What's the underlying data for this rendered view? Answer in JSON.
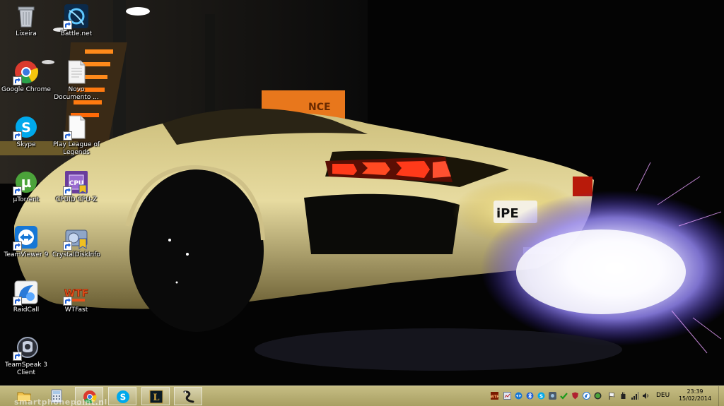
{
  "desktop": {
    "icons": [
      {
        "label": "Lixeira",
        "icon": "recycle-bin-icon"
      },
      {
        "label": "Battle.net",
        "icon": "battlenet-icon"
      },
      {
        "label": "Google Chrome",
        "icon": "chrome-icon"
      },
      {
        "label": "Novo Documento ...",
        "icon": "text-document-icon"
      },
      {
        "label": "Skype",
        "icon": "skype-icon"
      },
      {
        "label": "Play League of Legends",
        "icon": "league-document-icon"
      },
      {
        "label": "µTorrent",
        "icon": "utorrent-icon"
      },
      {
        "label": "CPUID CPU-Z",
        "icon": "cpuz-icon"
      },
      {
        "label": "TeamViewer 9",
        "icon": "teamviewer-icon"
      },
      {
        "label": "CrystalDiskInfo",
        "icon": "crystaldiskinfo-icon"
      },
      {
        "label": "RaidCall",
        "icon": "raidcall-icon"
      },
      {
        "label": "WTFast",
        "icon": "wtfast-icon"
      },
      {
        "label": "TeamSpeak 3 Client",
        "icon": "teamspeak-icon"
      }
    ],
    "wallpaper_text": {
      "sign": "NCE",
      "plate": "iPE"
    }
  },
  "taskbar": {
    "pinned": [
      {
        "app": "File Explorer",
        "icon": "file-explorer-icon"
      },
      {
        "app": "Calculator",
        "icon": "calculator-icon"
      },
      {
        "app": "Google Chrome",
        "icon": "chrome-icon"
      },
      {
        "app": "Skype",
        "icon": "skype-icon"
      },
      {
        "app": "League of Legends",
        "icon": "league-of-legends-icon"
      },
      {
        "app": "Unknown app",
        "icon": "serpent-app-icon"
      }
    ],
    "watermark": "smartphonepoint.nl",
    "tray_icons": [
      "wtfast-tray-icon",
      "network-monitor-icon",
      "teamviewer-tray-icon",
      "bluetooth-icon",
      "skype-tray-icon",
      "app-tray-icon",
      "checkmark-tray-icon",
      "shield-tray-icon",
      "raidcall-tray-icon",
      "utorrent-tray-icon",
      "flag-icon",
      "power-icon",
      "signal-bars-icon",
      "volume-icon"
    ],
    "language": "DEU",
    "time": "23:39",
    "date": "15/02/2014"
  },
  "colors": {
    "taskbar_top": "#c6bd84",
    "taskbar_bottom": "#a89f62",
    "car_body": "#e6d898",
    "flame": "#c9c3ff",
    "tail_light": "#ff3a1a"
  }
}
